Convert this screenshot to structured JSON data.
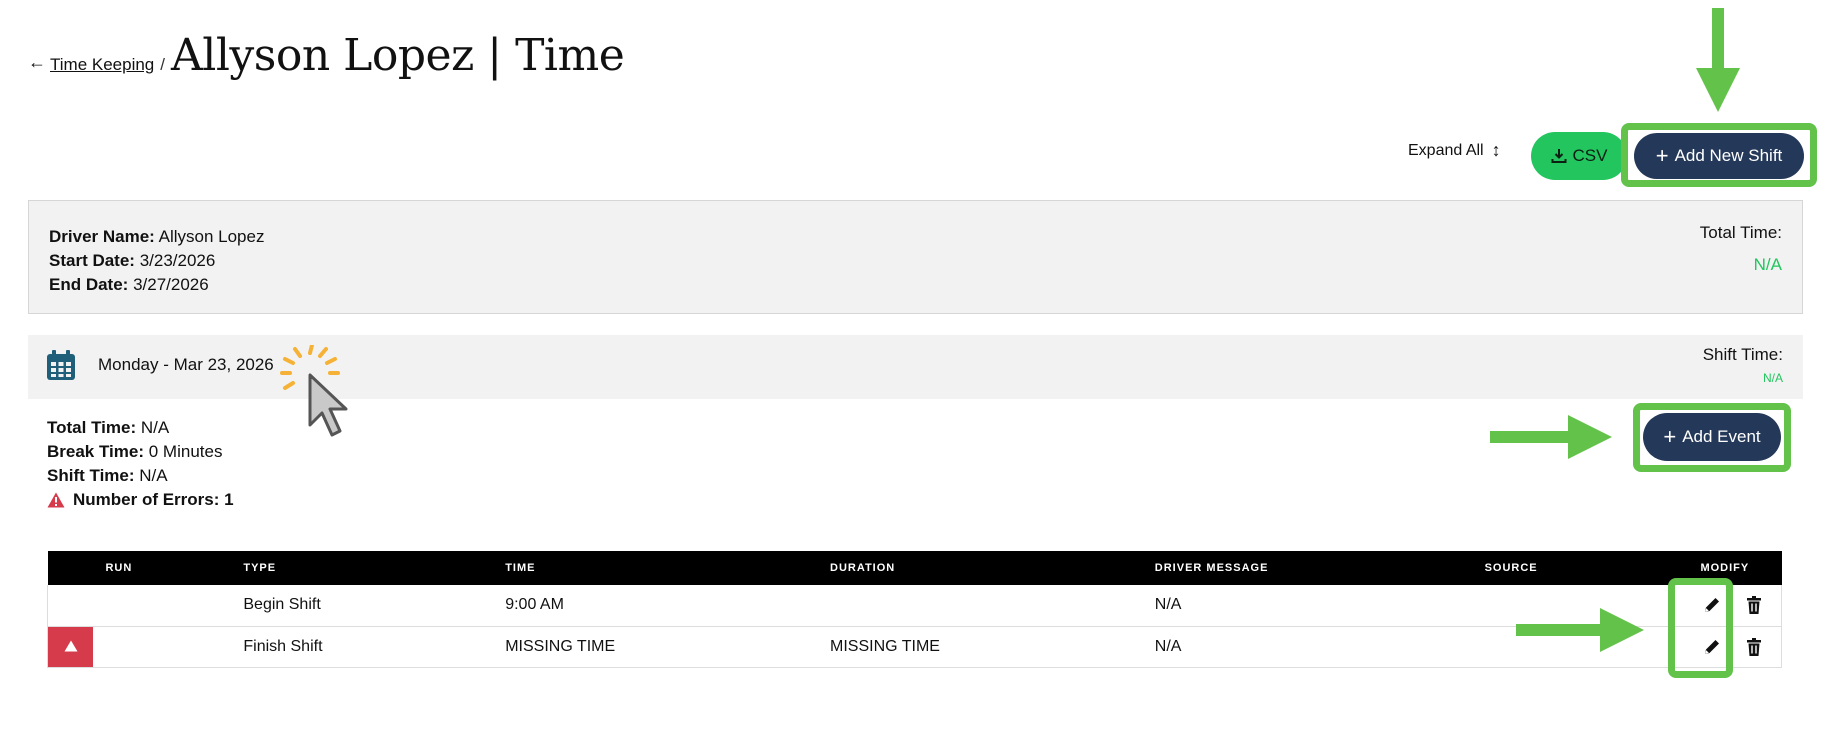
{
  "breadcrumb": {
    "back_arrow": "←",
    "parent_label": "Time Keeping",
    "separator": "/",
    "title": "Allyson Lopez | Time"
  },
  "toolbar": {
    "expand_all_label": "Expand All",
    "expand_icon": "↕",
    "csv_label": "CSV",
    "add_shift_label": "Add New Shift",
    "plus": "+"
  },
  "summary": {
    "driver_name_label": "Driver Name:",
    "driver_name": "Allyson Lopez",
    "start_date_label": "Start Date:",
    "start_date": "3/23/2026",
    "end_date_label": "End Date:",
    "end_date": "3/27/2026",
    "total_time_label": "Total Time:",
    "total_time": "N/A"
  },
  "day": {
    "title": "Monday - Mar 23, 2026",
    "shift_time_label": "Shift Time:",
    "shift_time": "N/A",
    "total_time_label": "Total Time:",
    "total_time": "N/A",
    "break_time_label": "Break Time:",
    "break_time": "0 Minutes",
    "shift_label": "Shift Time:",
    "shift_value": "N/A",
    "errors_label": "Number of Errors: 1",
    "add_event_label": "Add Event"
  },
  "table": {
    "headers": {
      "run": "RUN",
      "type": "TYPE",
      "time": "TIME",
      "duration": "DURATION",
      "message": "DRIVER MESSAGE",
      "source": "SOURCE",
      "modify": "MODIFY"
    },
    "rows": [
      {
        "run": "",
        "type": "Begin Shift",
        "time": "9:00 AM",
        "duration": "",
        "message": "N/A",
        "source": ""
      },
      {
        "run": "",
        "type": "Finish Shift",
        "time": "MISSING TIME",
        "duration": "MISSING TIME",
        "message": "N/A",
        "source": ""
      }
    ]
  },
  "colors": {
    "accent_green": "#22c55e",
    "navy": "#243859",
    "error_red": "#d63b4c",
    "annotation_green": "#63c24a"
  }
}
